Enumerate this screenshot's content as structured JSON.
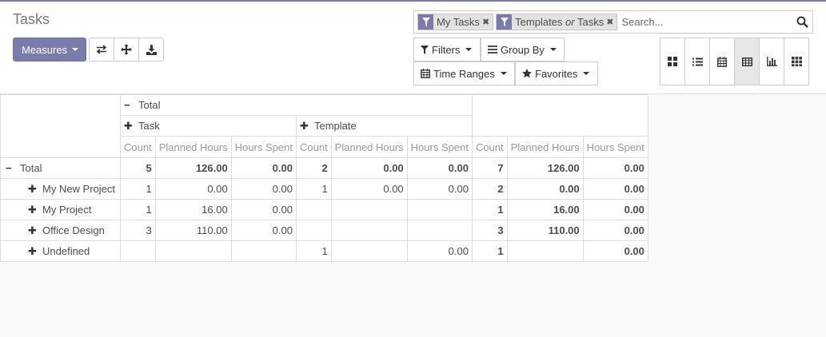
{
  "breadcrumb": "Tasks",
  "toolbar": {
    "measures_label": "Measures",
    "icons": [
      "flip-axis-icon",
      "expand-all-icon",
      "download-icon"
    ]
  },
  "search": {
    "facets": [
      {
        "icon": "filter-icon",
        "values": [
          {
            "text": "My Tasks"
          }
        ]
      },
      {
        "icon": "filter-icon",
        "values": [
          {
            "text": "Templates"
          },
          {
            "sep": "or"
          },
          {
            "text": "Tasks"
          }
        ]
      }
    ],
    "placeholder": "Search..."
  },
  "filters": {
    "filters_label": "Filters",
    "groupby_label": "Group By",
    "timeranges_label": "Time Ranges",
    "favorites_label": "Favorites"
  },
  "views": [
    {
      "name": "kanban",
      "active": false
    },
    {
      "name": "list",
      "active": false
    },
    {
      "name": "calendar",
      "active": false
    },
    {
      "name": "pivot",
      "active": true
    },
    {
      "name": "graph",
      "active": false
    },
    {
      "name": "grid",
      "active": false
    }
  ],
  "pivot": {
    "col_total": "Total",
    "col_groups": [
      "Task",
      "Template"
    ],
    "measures": [
      "Count",
      "Planned Hours",
      "Hours Spent"
    ],
    "rows": [
      {
        "label": "Total",
        "level": 0,
        "expanded": true,
        "cells": [
          "5",
          "126.00",
          "0.00",
          "2",
          "0.00",
          "0.00",
          "7",
          "126.00",
          "0.00"
        ]
      },
      {
        "label": "My New Project",
        "level": 1,
        "expanded": false,
        "cells": [
          "1",
          "0.00",
          "0.00",
          "1",
          "0.00",
          "0.00",
          "2",
          "0.00",
          "0.00"
        ]
      },
      {
        "label": "My Project",
        "level": 1,
        "expanded": false,
        "cells": [
          "1",
          "16.00",
          "0.00",
          "",
          "",
          "",
          "1",
          "16.00",
          "0.00"
        ]
      },
      {
        "label": "Office Design",
        "level": 1,
        "expanded": false,
        "cells": [
          "3",
          "110.00",
          "0.00",
          "",
          "",
          "",
          "3",
          "110.00",
          "0.00"
        ]
      },
      {
        "label": "Undefined",
        "level": 1,
        "expanded": false,
        "cells": [
          "",
          "",
          "",
          "1",
          "",
          "0.00",
          "1",
          "",
          "0.00"
        ]
      }
    ]
  },
  "colors": {
    "brand": "#7c7bad",
    "border": "#dedede"
  }
}
